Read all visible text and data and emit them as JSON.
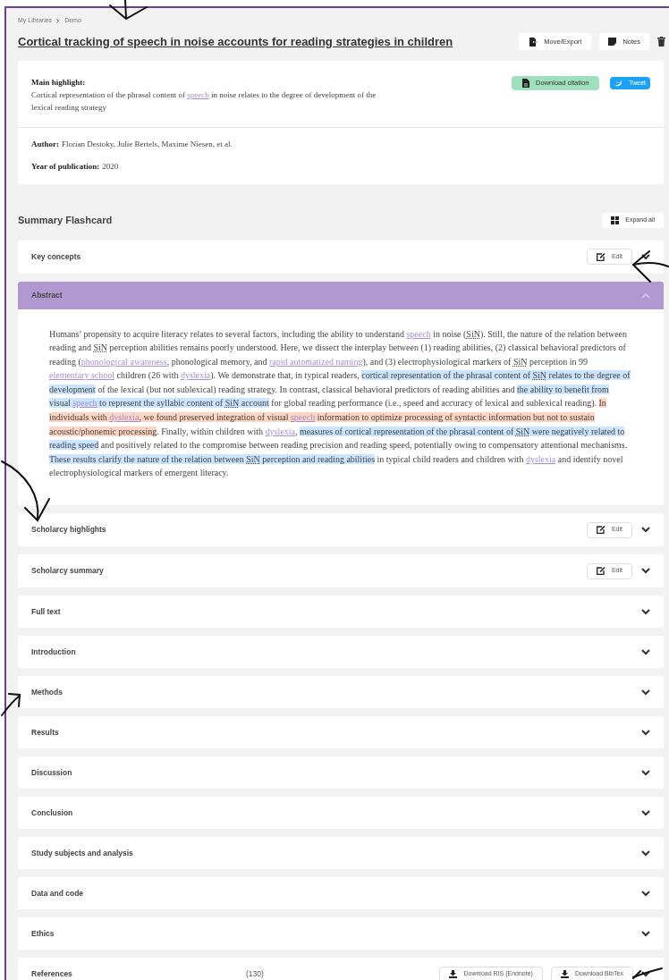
{
  "breadcrumb": [
    "My Libraries",
    "Demo"
  ],
  "title": "Cortical tracking of speech in noise accounts for reading strategies in children",
  "header_buttons": [
    {
      "label": "Move/Export"
    },
    {
      "label": "Notes"
    }
  ],
  "main_highlight": {
    "label": "Main highlight:",
    "segments": [
      {
        "text": "Cortical representation of the phrasal content of ",
        "kind": "text"
      },
      {
        "text": "speech",
        "kind": "link"
      },
      {
        "text": " in noise relates to the degree of development of the lexical reading strategy",
        "kind": "text"
      }
    ]
  },
  "download_citation": "Download citation",
  "tweet": "Tweet",
  "meta": [
    {
      "label": "Author:",
      "value": "Florian Destoky, Julie Bertels, Maxime Niesen, et al."
    },
    {
      "label": "Year of publication:",
      "value": "2020"
    }
  ],
  "flashcard_title": "Summary Flashcard",
  "expand_all": "Expand all",
  "sections": [
    {
      "title": "Key concepts",
      "expanded": false,
      "edit": "Edit"
    },
    {
      "title": "Abstract",
      "expanded": true,
      "abstract": [
        {
          "text": "Humans’ propensity to acquire literacy relates to several factors, including the ability to understand ",
          "kind": "text"
        },
        {
          "text": "speech",
          "kind": "link"
        },
        {
          "text": " in noise (",
          "kind": "text"
        },
        {
          "text": "SiN",
          "kind": "abbr"
        },
        {
          "text": "). Still, the nature of the relation between reading and ",
          "kind": "text"
        },
        {
          "text": "SiN",
          "kind": "abbr"
        },
        {
          "text": " perception abilities remains poorly understood. Here, we dissect the interplay between (1) reading abilities, (2) classical behavioral predictors of reading (",
          "kind": "text"
        },
        {
          "text": "phonological awareness",
          "kind": "link"
        },
        {
          "text": ", phonological memory, and ",
          "kind": "text"
        },
        {
          "text": "rapid automatized naming",
          "kind": "link"
        },
        {
          "text": "), and (3) electrophysiological markers of ",
          "kind": "text"
        },
        {
          "text": "SiN",
          "kind": "abbr"
        },
        {
          "text": " perception in 99 ",
          "kind": "text"
        },
        {
          "text": "elementary school",
          "kind": "link"
        },
        {
          "text": " children (26 with ",
          "kind": "text"
        },
        {
          "text": "dyslexia",
          "kind": "link"
        },
        {
          "text": "). We demonstrate that, in typical readers, ",
          "kind": "text"
        },
        {
          "text": "cortical representation of the phrasal content of ",
          "kind": "text",
          "color": "#cce5ff"
        },
        {
          "text": "SiN",
          "kind": "abbr",
          "color": "#cce5ff"
        },
        {
          "text": " relates to the degree of development",
          "kind": "text",
          "color": "#cce5ff"
        },
        {
          "text": " of the lexical (but not sublexical) reading strategy. In contrast, classical behavioral predictors of reading abilities and ",
          "kind": "text"
        },
        {
          "text": "the ability to benefit from visual ",
          "kind": "text",
          "color": "#cce5ff"
        },
        {
          "text": "speech",
          "kind": "link",
          "color": "#cce5ff"
        },
        {
          "text": " to represent the syllabic content of ",
          "kind": "text",
          "color": "#cce5ff"
        },
        {
          "text": "SiN",
          "kind": "abbr",
          "color": "#cce5ff"
        },
        {
          "text": " account",
          "kind": "text",
          "color": "#cce5ff"
        },
        {
          "text": " for global reading performance (i.e., speed and accuracy of lexical and sublexical reading). ",
          "kind": "text"
        },
        {
          "text": "In individuals with ",
          "kind": "text",
          "color": "#fdd5c2"
        },
        {
          "text": "dyslexia",
          "kind": "link",
          "color": "#fdd5c2"
        },
        {
          "text": ", we found preserved integration of visual ",
          "kind": "text",
          "color": "#fdd5c2"
        },
        {
          "text": "speech",
          "kind": "link",
          "color": "#fdd5c2"
        },
        {
          "text": " information to optimize processing of syntactic information but not to sustain acoustic/phonemic processing",
          "kind": "text",
          "color": "#fdd5c2"
        },
        {
          "text": ". Finally, within children with ",
          "kind": "text"
        },
        {
          "text": "dyslexia",
          "kind": "link"
        },
        {
          "text": ", ",
          "kind": "text"
        },
        {
          "text": "measures of cortical representation of the phrasal content of ",
          "kind": "text",
          "color": "#cce5ff"
        },
        {
          "text": "SiN",
          "kind": "abbr",
          "color": "#cce5ff"
        },
        {
          "text": " were negatively related to reading speed",
          "kind": "text",
          "color": "#cce5ff"
        },
        {
          "text": " and positively related to the compromise between reading precision and reading speed, potentially owing to compensatory attentional mechanisms. ",
          "kind": "text"
        },
        {
          "text": "These results clarify the nature of the relation between ",
          "kind": "text",
          "color": "#cce5ff"
        },
        {
          "text": "SiN",
          "kind": "abbr",
          "color": "#cce5ff"
        },
        {
          "text": " perception and reading abilities",
          "kind": "text",
          "color": "#cce5ff"
        },
        {
          "text": " in typical child readers and children with ",
          "kind": "text"
        },
        {
          "text": "dyslexia",
          "kind": "link"
        },
        {
          "text": " and identify novel electrophysiological markers of emergent literacy.",
          "kind": "text"
        }
      ]
    },
    {
      "title": "Scholarcy highlights",
      "expanded": false,
      "edit": "Edit"
    },
    {
      "title": "Scholarcy summary",
      "expanded": false,
      "edit": "Edit"
    },
    {
      "title": "Full text",
      "expanded": false
    },
    {
      "title": "Introduction",
      "expanded": false
    },
    {
      "title": "Methods",
      "expanded": false
    },
    {
      "title": "Results",
      "expanded": false
    },
    {
      "title": "Discussion",
      "expanded": false
    },
    {
      "title": "Conclusion",
      "expanded": false
    },
    {
      "title": "Study subjects and analysis",
      "expanded": false
    },
    {
      "title": "Data and code",
      "expanded": false
    },
    {
      "title": "Ethics",
      "expanded": false
    },
    {
      "title": "References",
      "expanded": false,
      "count": "(130)",
      "downloads": [
        "Download RIS (Endnote)",
        "Download BibTex"
      ]
    }
  ]
}
